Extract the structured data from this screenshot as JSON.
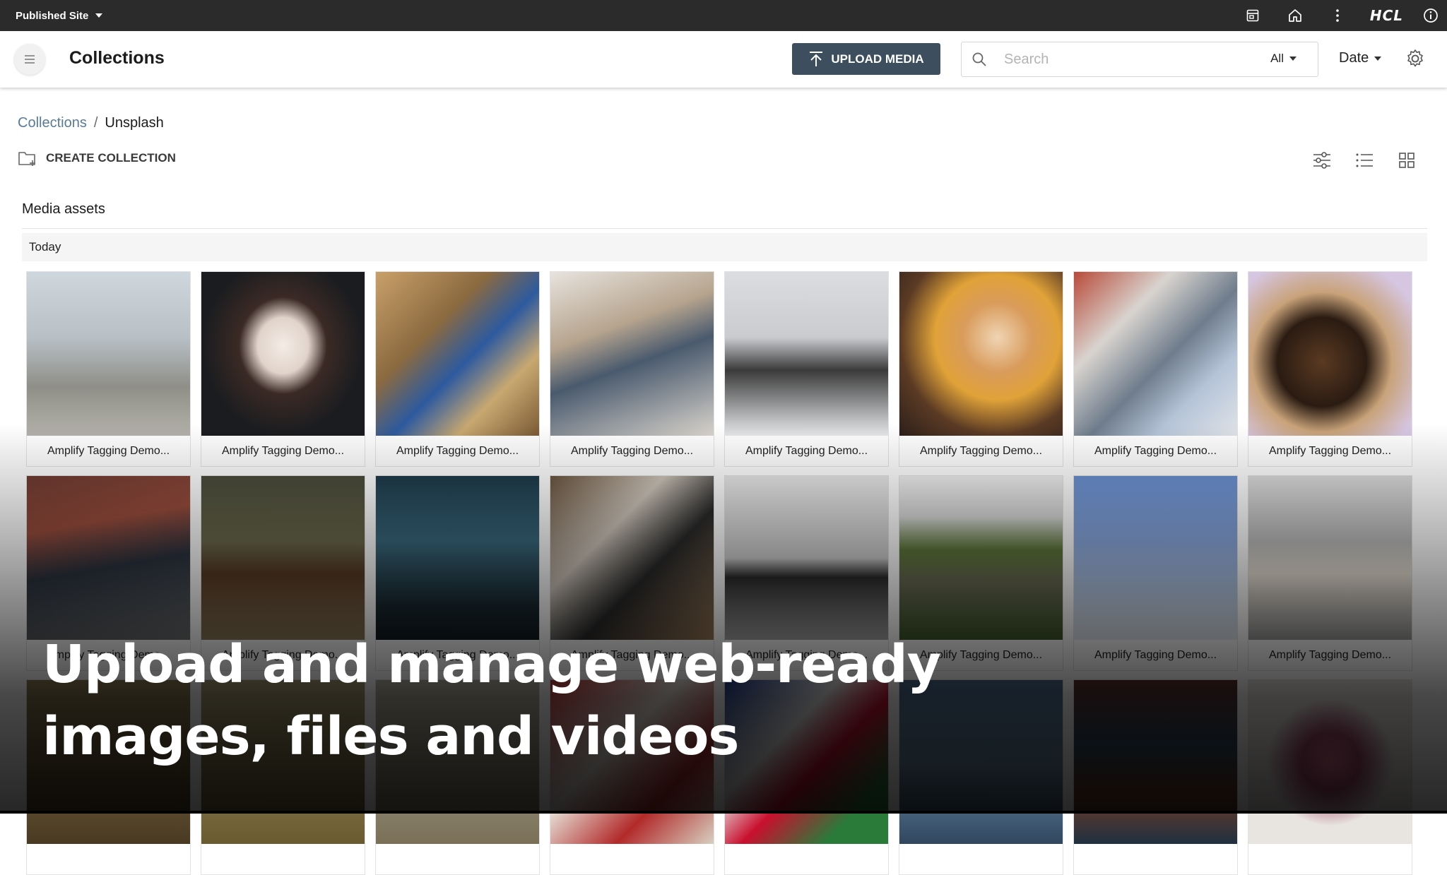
{
  "topbar": {
    "site_selector": "Published Site",
    "icons": [
      "preview-icon",
      "home-icon",
      "more-vert-icon",
      "info-icon"
    ],
    "brand": "HCL"
  },
  "header": {
    "title": "Collections",
    "upload_label": "UPLOAD MEDIA",
    "search_placeholder": "Search",
    "search_value": "",
    "scope_value": "All",
    "sort_value": "Date",
    "colors": {
      "upload_bg": "#3d4e5f",
      "topbar_bg": "#2b2b2b"
    }
  },
  "breadcrumb": {
    "root": "Collections",
    "separator": "/",
    "current": "Unsplash"
  },
  "actions": {
    "create_collection": "CREATE COLLECTION"
  },
  "section": {
    "title": "Media assets",
    "group": "Today"
  },
  "assets": [
    {
      "caption": "Amplify Tagging Demo..."
    },
    {
      "caption": "Amplify Tagging Demo..."
    },
    {
      "caption": "Amplify Tagging Demo..."
    },
    {
      "caption": "Amplify Tagging Demo..."
    },
    {
      "caption": "Amplify Tagging Demo..."
    },
    {
      "caption": "Amplify Tagging Demo..."
    },
    {
      "caption": "Amplify Tagging Demo..."
    },
    {
      "caption": "Amplify Tagging Demo..."
    },
    {
      "caption": "Amplify Tagging Demo..."
    },
    {
      "caption": "Amplify Tagging Demo..."
    },
    {
      "caption": "Amplify Tagging Demo..."
    },
    {
      "caption": "Amplify Tagging Demo..."
    },
    {
      "caption": "Amplify Tagging Demo..."
    },
    {
      "caption": "Amplify Tagging Demo..."
    },
    {
      "caption": "Amplify Tagging Demo..."
    },
    {
      "caption": "Amplify Tagging Demo..."
    },
    {
      "caption": ""
    },
    {
      "caption": ""
    },
    {
      "caption": ""
    },
    {
      "caption": ""
    },
    {
      "caption": ""
    },
    {
      "caption": ""
    },
    {
      "caption": ""
    },
    {
      "caption": ""
    }
  ],
  "overlay": {
    "caption": "Upload and manage web-ready images, files and videos"
  }
}
